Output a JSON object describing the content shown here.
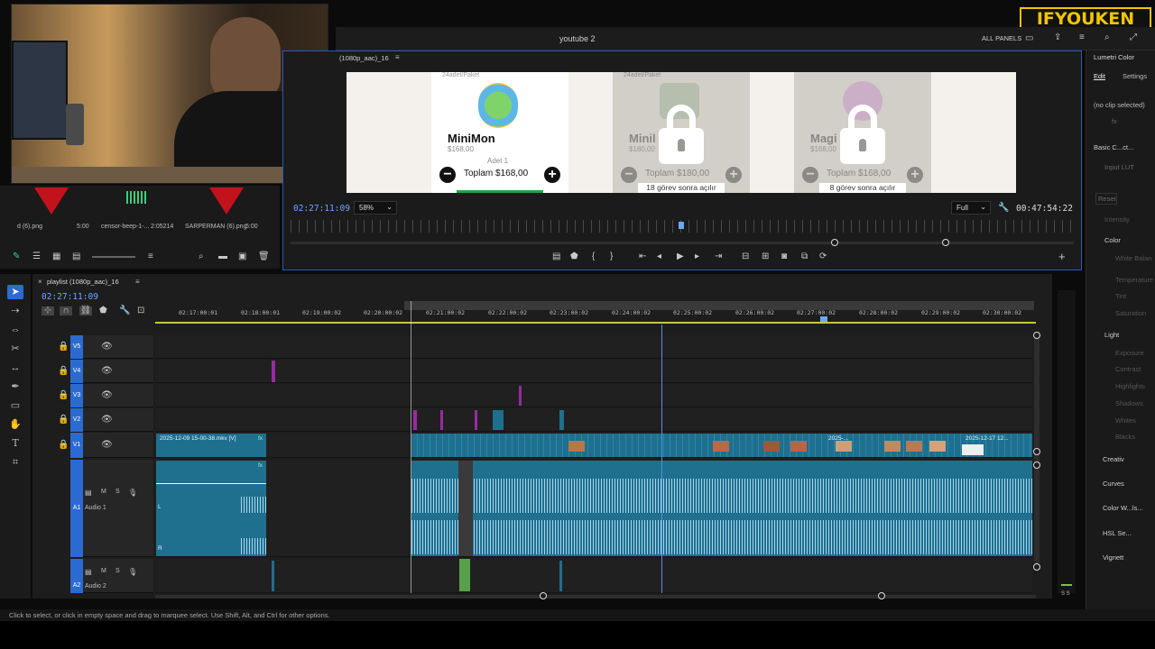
{
  "brand": {
    "logo_text": "IFYOUKEN"
  },
  "app": {
    "window_title": "youtube 2",
    "workspace_label": "ALL PANELS"
  },
  "monitor": {
    "tab_title": "(1080p_aac)_16",
    "timecode": "02:27:11:09",
    "zoom_value": "58%",
    "resolution_value": "Full",
    "duration": "00:47:54:22",
    "cards": [
      {
        "header": "24adet/Paket",
        "name": "MiniMon",
        "price": "$168,00",
        "qty": "Adet 1",
        "total": "Toplam $168,00",
        "locked": false
      },
      {
        "header": "24adet/Paket",
        "name": "Minil",
        "price": "$180,00",
        "total": "Toplam $180,00",
        "footer": "18 görev sonra açılır",
        "locked": true
      },
      {
        "header": "",
        "name": "Magi      lt",
        "price": "$168,00",
        "total": "Toplam $168,00",
        "footer": "8 görev sonra açılır",
        "locked": true
      }
    ]
  },
  "bin": {
    "items": [
      {
        "label": "d (6).png",
        "meta": "5:00"
      },
      {
        "label": "censor-beep-1-...",
        "meta": "2:05214"
      },
      {
        "label": "SARPERMAN (6).png",
        "meta": "5:00"
      }
    ]
  },
  "timeline": {
    "sequence_title": "playlist (1080p_aac)_16",
    "timecode": "02:27:11:09",
    "ruler": [
      "02:17:00:01",
      "02:18:00:01",
      "02:19:00:02",
      "02:20:00:02",
      "02:21:00:02",
      "02:22:00:02",
      "02:23:00:02",
      "02:24:00:02",
      "02:25:00:02",
      "02:26:00:02",
      "02:27:00:02",
      "02:28:00:02",
      "02:29:00:02",
      "02:30:00:02"
    ],
    "tracks": {
      "v5": "V5",
      "v4": "V4",
      "v3": "V3",
      "v2": "V2",
      "v1": "V1",
      "a1": "A1",
      "a1_name": "Audio 1",
      "a2": "A2",
      "a2_name": "Audio 2"
    },
    "clips": {
      "v1_first": "2025-12-09 15-00-38.mkv [V]",
      "v1_mid": "2025-...",
      "v1_last": "2025-12-17 12...",
      "fx": "fx",
      "l_channel": "L",
      "r_channel": "R"
    }
  },
  "lumetri": {
    "title": "Lumetri Color",
    "tab_edit": "Edit",
    "tab_settings": "Settings",
    "no_clip": "(no clip selected)",
    "fx_label": "fx",
    "basic_correction": "Basic C...ct...",
    "input_lut": "Input LUT",
    "reset": "Reset",
    "intensity": "Intensity",
    "color": "Color",
    "white_balance": "White Balan",
    "temperature": "Temperature",
    "tint": "Tint",
    "saturation": "Saturation",
    "light": "Light",
    "exposure": "Exposure",
    "contrast": "Contrast",
    "highlights": "Highlights",
    "shadows": "Shadows",
    "whites": "Whites",
    "blacks": "Blacks",
    "creative": "Creativ",
    "curves": "Curves",
    "color_wheels": "Color W...ls...",
    "hsl": "HSL Se...",
    "vignette": "Vignett",
    "meter_label": "S S"
  },
  "status_bar": {
    "text": "Click to select, or click in empty space and drag to marquee select. Use Shift, Alt, and Ctrl for other options."
  },
  "colors": {
    "accent_blue": "#2b6bd1",
    "clip_teal": "#1f6f8f",
    "brand_yellow": "#f4c400"
  }
}
